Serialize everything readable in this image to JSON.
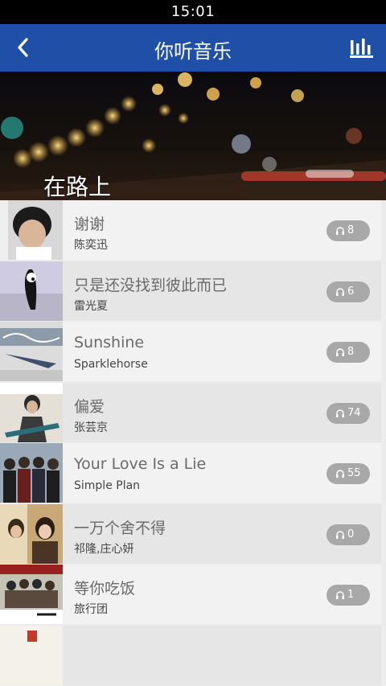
{
  "status_bar": {
    "time": "15:01"
  },
  "app_bar": {
    "title": "你听音乐",
    "back_icon": "back-chevron-icon",
    "right_icon": "equalizer-icon"
  },
  "banner": {
    "title": "在路上"
  },
  "colors": {
    "app_bar": "#1f4fa6",
    "row_light": "#f2f2f2",
    "row_dark": "#e6e6e6",
    "badge": "#a8a8a8"
  },
  "songs": [
    {
      "title": "谢谢",
      "artist": "陈奕迅",
      "plays": "8"
    },
    {
      "title": "只是还没找到彼此而已",
      "artist": "雷光夏",
      "plays": "6"
    },
    {
      "title": "Sunshine",
      "artist": "Sparklehorse",
      "plays": "8"
    },
    {
      "title": "偏爱",
      "artist": "张芸京",
      "plays": "74"
    },
    {
      "title": "Your Love Is a Lie",
      "artist": "Simple Plan",
      "plays": "55"
    },
    {
      "title": "一万个舍不得",
      "artist": "祁隆,庄心妍",
      "plays": "0"
    },
    {
      "title": "等你吃饭",
      "artist": "旅行团",
      "plays": "1"
    },
    {
      "title": "",
      "artist": "",
      "plays": ""
    }
  ]
}
